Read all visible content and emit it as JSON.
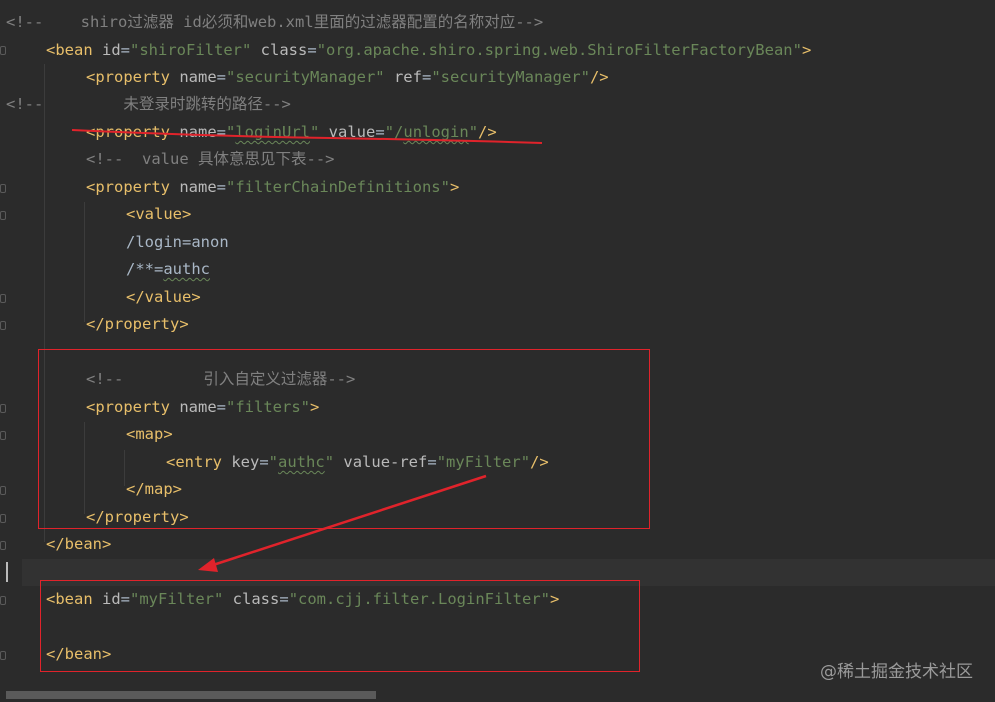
{
  "code": {
    "line1": {
      "open": "<!--",
      "text1": "    shiro",
      "cn1": "过滤器",
      "text2": " id",
      "cn2": "必须和",
      "text3": "web.xml",
      "cn3": "里面的过滤器配置的名称对应",
      "close": "-->"
    },
    "line2": {
      "tag": "<bean ",
      "attr1": "id",
      "eq1": "=",
      "val1": "\"shiroFilter\"",
      "attr2": " class",
      "eq2": "=",
      "val2": "\"org.apache.shiro.spring.web.ShiroFilterFactoryBean\"",
      "end": ">"
    },
    "line3": {
      "tag": "<property ",
      "attr1": "name",
      "eq1": "=",
      "val1": "\"securityManager\"",
      "attr2": " ref",
      "eq2": "=",
      "val2": "\"securityManager\"",
      "end": "/>"
    },
    "line4": {
      "open": "<!--",
      "cn": "未登录时跳转的路径",
      "close": "-->"
    },
    "line5": {
      "tag": "<property ",
      "attr1": "name",
      "eq1": "=",
      "val1a": "\"",
      "val1b": "loginUrl",
      "val1c": "\"",
      "attr2": " value",
      "eq2": "=",
      "val2a": "\"/",
      "val2b": "unlogin",
      "val2c": "\"",
      "end": "/>"
    },
    "line6": {
      "open": "<!--  value ",
      "cn": "具体意思见下表",
      "close": "-->"
    },
    "line7": {
      "tag": "<property ",
      "attr1": "name",
      "eq1": "=",
      "val1": "\"filterChainDefinitions\"",
      "end": ">"
    },
    "line8": {
      "tag": "<value>"
    },
    "line9": {
      "text": "/login=anon"
    },
    "line10": {
      "text1": "/**=",
      "text2": "authc"
    },
    "line11": {
      "tag": "</value>"
    },
    "line12": {
      "tag": "</property>"
    },
    "line14": {
      "open": "<!--",
      "cn": "引入自定义过滤器",
      "close": "-->"
    },
    "line15": {
      "tag": "<property ",
      "attr1": "name",
      "eq1": "=",
      "val1": "\"filters\"",
      "end": ">"
    },
    "line16": {
      "tag": "<map>"
    },
    "line17": {
      "tag": "<entry ",
      "attr1": "key",
      "eq1": "=",
      "val1a": "\"",
      "val1b": "authc",
      "val1c": "\"",
      "attr2": " value-ref",
      "eq2": "=",
      "val2": "\"myFilter\"",
      "end": "/>"
    },
    "line18": {
      "tag": "</map>"
    },
    "line19": {
      "tag": "</property>"
    },
    "line20": {
      "tag": "</bean>"
    },
    "line22": {
      "tag": "<bean ",
      "attr1": "id",
      "eq1": "=",
      "val1": "\"myFilter\"",
      "attr2": " class",
      "eq2": "=",
      "val2": "\"com.cjj.filter.LoginFilter\"",
      "end": ">"
    },
    "line24": {
      "tag": "</bean>"
    }
  },
  "watermark": "@稀土掘金技术社区",
  "colors": {
    "background": "#2b2b2b",
    "tag": "#e8bf6a",
    "attribute": "#bababa",
    "string": "#6a8759",
    "comment": "#808080",
    "annotation": "#e0232b"
  }
}
